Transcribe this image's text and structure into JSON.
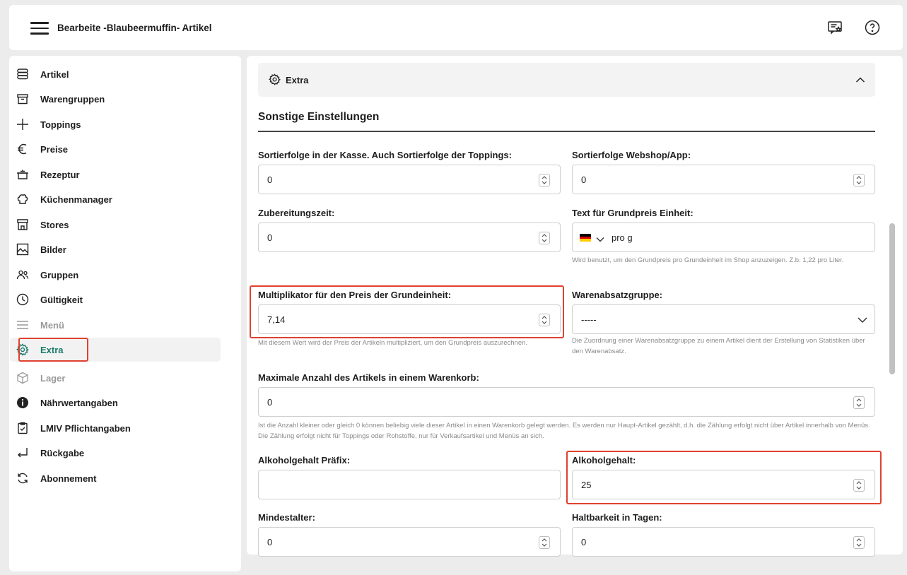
{
  "header": {
    "title": "Bearbeite -Blaubeermuffin- Artikel"
  },
  "sidebar": {
    "items": [
      {
        "label": "Artikel",
        "icon": "database-icon",
        "state": "normal"
      },
      {
        "label": "Warengruppen",
        "icon": "archive-icon",
        "state": "normal"
      },
      {
        "label": "Toppings",
        "icon": "plus-icon",
        "state": "normal"
      },
      {
        "label": "Preise",
        "icon": "euro-icon",
        "state": "normal"
      },
      {
        "label": "Rezeptur",
        "icon": "pot-icon",
        "state": "normal"
      },
      {
        "label": "Küchenmanager",
        "icon": "chef-hat-icon",
        "state": "normal"
      },
      {
        "label": "Stores",
        "icon": "store-icon",
        "state": "normal"
      },
      {
        "label": "Bilder",
        "icon": "image-icon",
        "state": "normal"
      },
      {
        "label": "Gruppen",
        "icon": "users-icon",
        "state": "normal"
      },
      {
        "label": "Gültigkeit",
        "icon": "clock-icon",
        "state": "normal"
      },
      {
        "label": "Menü",
        "icon": "menu-lines-icon",
        "state": "disabled"
      },
      {
        "label": "Extra",
        "icon": "gear-icon",
        "state": "active"
      },
      {
        "label": "Lager",
        "icon": "box-icon",
        "state": "disabled"
      },
      {
        "label": "Nährwertangaben",
        "icon": "info-icon",
        "state": "normal"
      },
      {
        "label": "LMIV Pflichtangaben",
        "icon": "clipboard-check-icon",
        "state": "normal"
      },
      {
        "label": "Rückgabe",
        "icon": "return-arrow-icon",
        "state": "normal"
      },
      {
        "label": "Abonnement",
        "icon": "refresh-icon",
        "state": "normal"
      }
    ]
  },
  "accordion": {
    "label": "Extra"
  },
  "section": {
    "title": "Sonstige Einstellungen"
  },
  "fields": {
    "sort_kasse": {
      "label": "Sortierfolge in der Kasse. Auch Sortierfolge der Toppings:",
      "value": "0"
    },
    "sort_webshop": {
      "label": "Sortierfolge Webshop/App:",
      "value": "0"
    },
    "zubereitung": {
      "label": "Zubereitungszeit:",
      "value": "0"
    },
    "grundpreis_text": {
      "label": "Text für Grundpreis Einheit:",
      "value": "pro g",
      "help": "Wird benutzt, um den Grundpreis pro Grundeinheit im Shop anzuzeigen. Z.b. 1,22 pro Liter."
    },
    "multiplikator": {
      "label": "Multiplikator für den Preis der Grundeinheit:",
      "value": "7,14",
      "help": "Mit diesem Wert wird der Preis der Artikeln multipliziert, um den Grundpreis auszurechnen."
    },
    "warenabsatz": {
      "label": "Warenabsatzgruppe:",
      "value": "-----",
      "help": "Die Zuordnung einer Warenabsatzgruppe zu einem Artikel dient der Erstellung von Statistiken über den Warenabsatz."
    },
    "max_anzahl": {
      "label": "Maximale Anzahl des Artikels in einem Warenkorb:",
      "value": "0",
      "help": "Ist die Anzahl kleiner oder gleich 0 können beliebig viele dieser Artikel in einen Warenkorb gelegt werden. Es werden nur Haupt-Artikel gezählt, d.h. die Zählung erfolgt nicht über Artikel innerhalb von Menüs. Die Zählung erfolgt nicht für Toppings oder Rohstoffe, nur für Verkaufsartikel und Menüs an sich."
    },
    "alkohol_praefix": {
      "label": "Alkoholgehalt Präfix:",
      "value": ""
    },
    "alkohol": {
      "label": "Alkoholgehalt:",
      "value": "25"
    },
    "mindestalter": {
      "label": "Mindestalter:",
      "value": "0"
    },
    "haltbarkeit": {
      "label": "Haltbarkeit in Tagen:",
      "value": "0"
    }
  },
  "colors": {
    "highlight": "#e0412f",
    "active_text": "#1a7a6a"
  }
}
